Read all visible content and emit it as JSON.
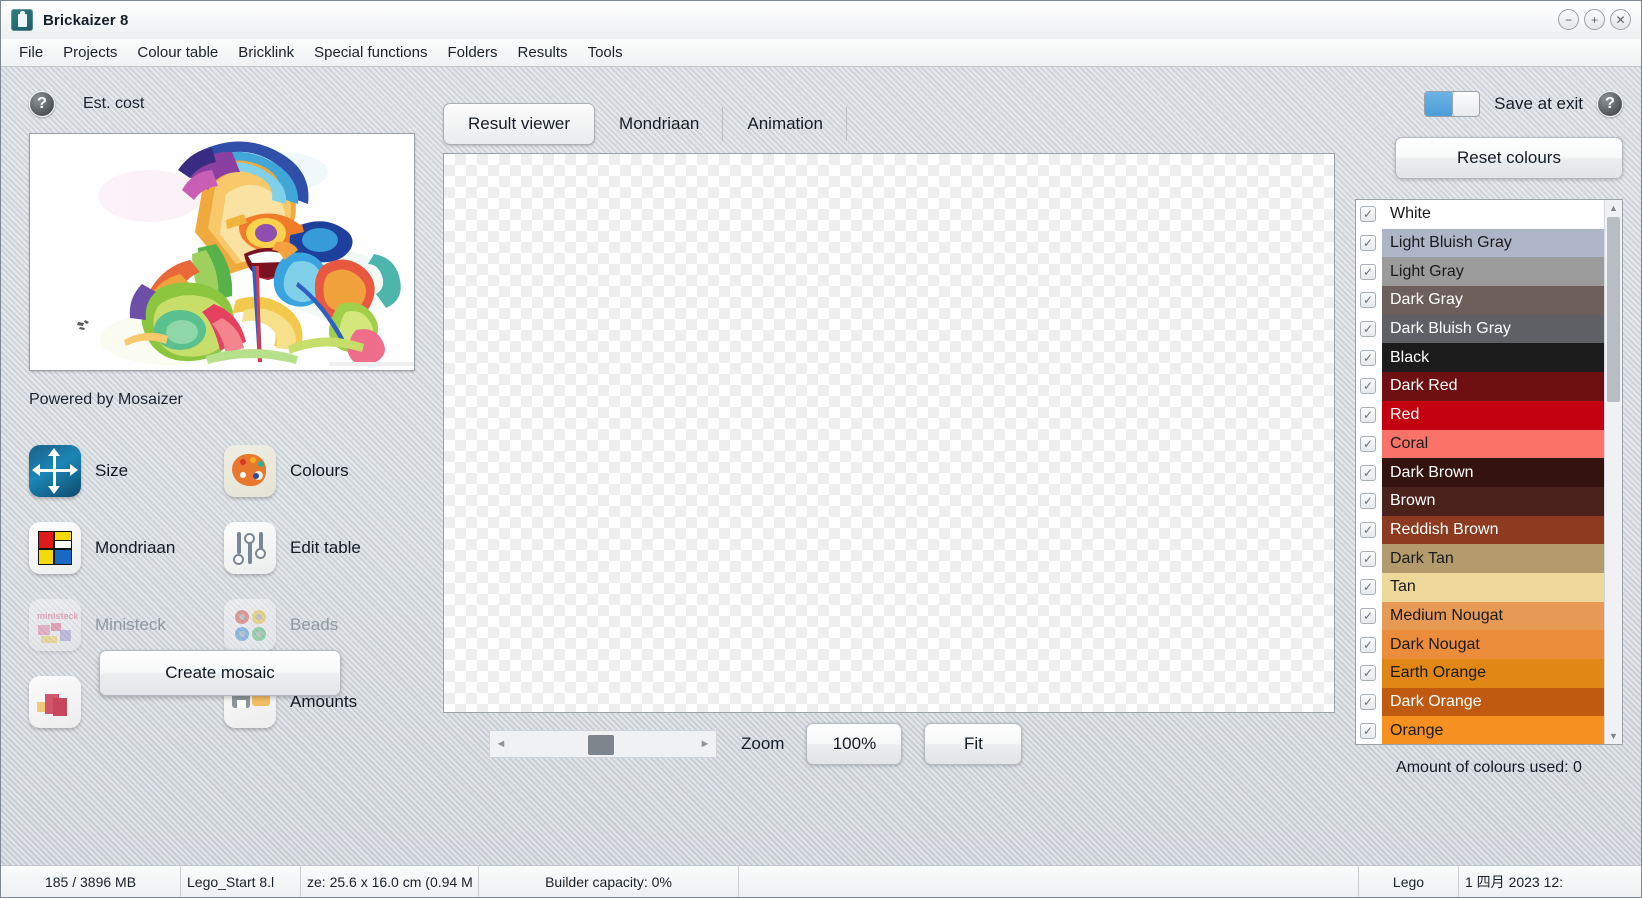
{
  "window": {
    "title": "Brickaizer 8",
    "icon": "app-brick-icon",
    "controls": [
      {
        "name": "minimize",
        "glyph": "−"
      },
      {
        "name": "maximize",
        "glyph": "+"
      },
      {
        "name": "close",
        "glyph": "✕"
      }
    ]
  },
  "menubar": {
    "items": [
      "File",
      "Projects",
      "Colour table",
      "Bricklink",
      "Special functions",
      "Folders",
      "Results",
      "Tools"
    ]
  },
  "toolbar": {
    "help_icon": "?",
    "est_cost_label": "Est. cost",
    "save_at_exit_label": "Save at exit",
    "save_at_exit_on": true,
    "right_help_icon": "?"
  },
  "left_panel": {
    "preview_caption": "Powered by Mosaizer",
    "tiles": [
      {
        "label": "Size",
        "icon": "size-icon",
        "enabled": true
      },
      {
        "label": "Colours",
        "icon": "palette-icon",
        "enabled": true
      },
      {
        "label": "Mondriaan",
        "icon": "mondriaan-icon",
        "enabled": true
      },
      {
        "label": "Edit table",
        "icon": "sliders-icon",
        "enabled": true
      },
      {
        "label": "Ministeck",
        "icon": "ministeck-icon",
        "enabled": false
      },
      {
        "label": "Beads",
        "icon": "beads-icon",
        "enabled": false
      },
      {
        "label": "Amounts",
        "icon": "amounts-icon",
        "enabled": true
      }
    ],
    "create_button": "Create mosaic"
  },
  "center_panel": {
    "tabs": [
      {
        "label": "Result viewer",
        "active": true
      },
      {
        "label": "Mondriaan",
        "active": false
      },
      {
        "label": "Animation",
        "active": false
      }
    ],
    "zoom_label": "Zoom",
    "zoom_value": "100%",
    "fit_label": "Fit"
  },
  "right_panel": {
    "reset_button": "Reset colours",
    "amount_used": "Amount of colours used: 0",
    "colours": [
      {
        "name": "White",
        "hex": "#ffffff",
        "text": "#1a1a1a",
        "checked": true
      },
      {
        "name": "Light Bluish Gray",
        "hex": "#aeb5c7",
        "text": "#1a1a1a",
        "checked": true
      },
      {
        "name": "Light Gray",
        "hex": "#9b9b9b",
        "text": "#1a1a1a",
        "checked": true
      },
      {
        "name": "Dark Gray",
        "hex": "#6d5f5b",
        "text": "#ffffff",
        "checked": true
      },
      {
        "name": "Dark Bluish Gray",
        "hex": "#5d6065",
        "text": "#ffffff",
        "checked": true
      },
      {
        "name": "Black",
        "hex": "#1b1b1b",
        "text": "#ffffff",
        "checked": true
      },
      {
        "name": "Dark Red",
        "hex": "#6e0f12",
        "text": "#ffffff",
        "checked": true
      },
      {
        "name": "Red",
        "hex": "#c20010",
        "text": "#ffffff",
        "checked": true
      },
      {
        "name": "Coral",
        "hex": "#fa7268",
        "text": "#1a1a1a",
        "checked": true
      },
      {
        "name": "Dark Brown",
        "hex": "#34130f",
        "text": "#ffffff",
        "checked": true
      },
      {
        "name": "Brown",
        "hex": "#4a221b",
        "text": "#ffffff",
        "checked": true
      },
      {
        "name": "Reddish Brown",
        "hex": "#8c3a20",
        "text": "#ffffff",
        "checked": true
      },
      {
        "name": "Dark Tan",
        "hex": "#b49b6d",
        "text": "#1a1a1a",
        "checked": true
      },
      {
        "name": "Tan",
        "hex": "#eed99b",
        "text": "#1a1a1a",
        "checked": true
      },
      {
        "name": "Medium Nougat",
        "hex": "#e79a55",
        "text": "#1a1a1a",
        "checked": true
      },
      {
        "name": "Dark Nougat",
        "hex": "#ec8d3c",
        "text": "#1a1a1a",
        "checked": true
      },
      {
        "name": "Earth Orange",
        "hex": "#e08715",
        "text": "#1a1a1a",
        "checked": true
      },
      {
        "name": "Dark Orange",
        "hex": "#bf5a10",
        "text": "#ffffff",
        "checked": true
      },
      {
        "name": "Orange",
        "hex": "#f59021",
        "text": "#1a1a1a",
        "checked": true
      }
    ],
    "checkbox_glyph": "✓"
  },
  "statusbar": {
    "memory": "185 / 3896 MB",
    "project": "Lego_Start 8.l",
    "size": "ze: 25.6 x 16.0 cm (0.94 M",
    "builder_capacity": "Builder capacity: 0%",
    "blank": "",
    "mode": "Lego",
    "datetime": "1 四月 2023  12:"
  }
}
